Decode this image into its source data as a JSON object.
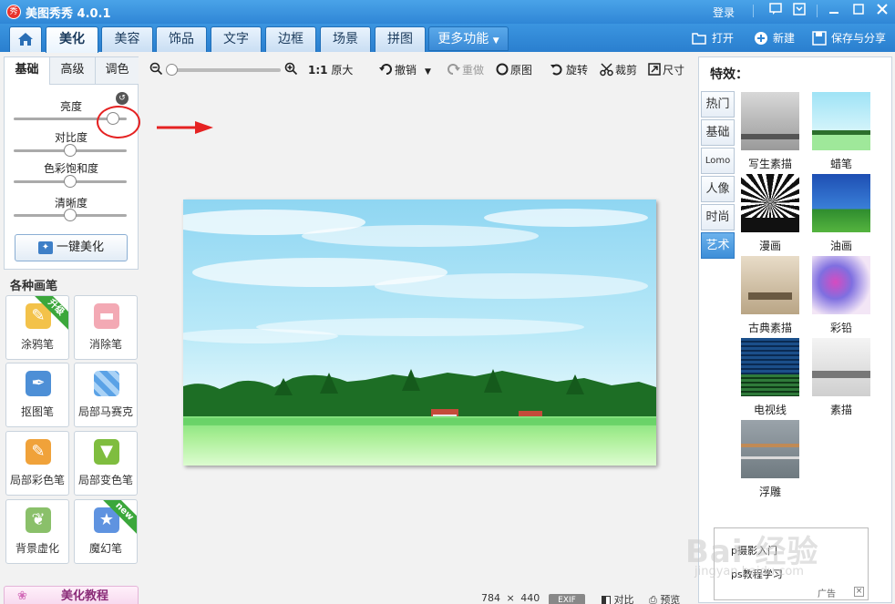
{
  "window": {
    "title": "美图秀秀 4.0.1",
    "logo_char": "秀",
    "login": "登录"
  },
  "tabs": [
    "美化",
    "美容",
    "饰品",
    "文字",
    "边框",
    "场景",
    "拼图"
  ],
  "active_tab": "美化",
  "more_tab": "更多功能",
  "actions": {
    "open": "打开",
    "new": "新建",
    "save": "保存与分享"
  },
  "toolbar": {
    "original_size_ratio": "1:1",
    "original_size": "原大",
    "undo": "撤销",
    "redo": "重做",
    "original": "原图",
    "rotate": "旋转",
    "crop": "裁剪",
    "size": "尺寸",
    "zoom_level": 0.0
  },
  "left_panel": {
    "subtabs": [
      "基础",
      "高级",
      "调色"
    ],
    "sliders": [
      {
        "label": "亮度",
        "value": 0.88
      },
      {
        "label": "对比度",
        "value": 0.5
      },
      {
        "label": "色彩饱和度",
        "value": 0.5
      },
      {
        "label": "清晰度",
        "value": 0.5
      }
    ],
    "one_key": "一键美化"
  },
  "brushes": {
    "header": "各种画笔",
    "items": [
      {
        "label": "涂鸦笔",
        "badge": "升级"
      },
      {
        "label": "消除笔",
        "badge": ""
      },
      {
        "label": "抠图笔",
        "badge": ""
      },
      {
        "label": "局部马赛克",
        "badge": ""
      },
      {
        "label": "局部彩色笔",
        "badge": ""
      },
      {
        "label": "局部变色笔",
        "badge": ""
      },
      {
        "label": "背景虚化",
        "badge": ""
      },
      {
        "label": "魔幻笔",
        "badge": "new"
      }
    ]
  },
  "tutorial": "美化教程",
  "status": {
    "width": "784",
    "times": "×",
    "height": "440",
    "exif": "EXIF",
    "compare": "对比",
    "preview": "预览"
  },
  "right_panel": {
    "title": "特效：",
    "categories": [
      "热门",
      "基础",
      "Lomo",
      "人像",
      "时尚",
      "艺术"
    ],
    "active_category": "艺术",
    "effects": [
      "写生素描",
      "蜡笔",
      "漫画",
      "油画",
      "古典素描",
      "彩铅",
      "电视线",
      "素描",
      "浮雕"
    ]
  },
  "ad": {
    "line1": "p摄影入门",
    "line2": "ps教程学习",
    "label": "广告",
    "close": "×"
  },
  "watermark": {
    "text": "Bai 经验",
    "sub": "jingyan.baidu.com"
  },
  "colors": {
    "accent": "#2f86d6",
    "highlight": "#e52222",
    "badge": "#3ba73b"
  }
}
